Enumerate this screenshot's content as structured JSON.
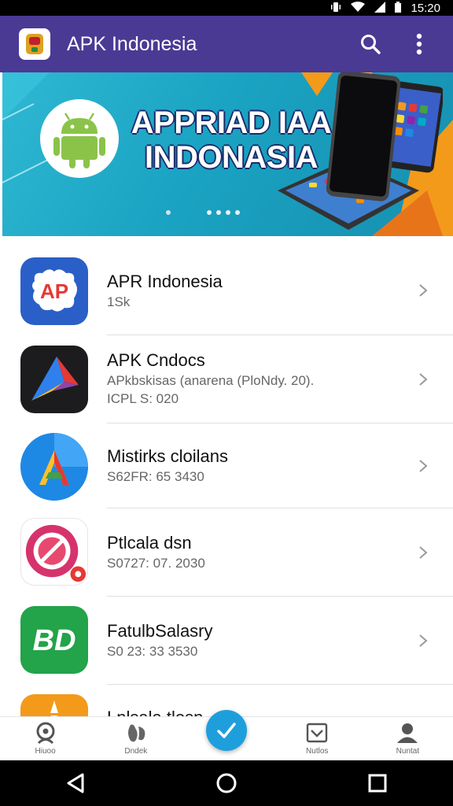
{
  "status_bar": {
    "time": "15:20"
  },
  "app_bar": {
    "title": "APK Indonesia"
  },
  "banner": {
    "title": "APPRIAD IAA INDONASIA",
    "slides": 5
  },
  "apps": [
    {
      "name": "APR Indonesia",
      "subtitle": "1Sk",
      "subtitle2": "",
      "icon": "ap-badge-icon"
    },
    {
      "name": "APK Cndocs",
      "subtitle": "APkbskisas (anarena (PloNdy. 20).",
      "subtitle2": "ICPL S: 020",
      "icon": "paper-plane-icon"
    },
    {
      "name": "Mistirks cloilans",
      "subtitle": "S62FR: 65 3430",
      "subtitle2": "",
      "icon": "a-logo-icon"
    },
    {
      "name": "Ptlcala dsn",
      "subtitle": "S0727: 07. 2030",
      "subtitle2": "",
      "icon": "compass-icon"
    },
    {
      "name": "FatulbSalasry",
      "subtitle": "S0 23: 33 3530",
      "subtitle2": "",
      "icon": "bd-logo-icon"
    },
    {
      "name": "Lnlsala tlosn",
      "subtitle": "",
      "subtitle2": "",
      "icon": "sun-logo-icon"
    }
  ],
  "bottom_nav": [
    {
      "label": "Hiuoo",
      "icon": "home-icon"
    },
    {
      "label": "Dndek",
      "icon": "bean-icon"
    },
    {
      "label": "",
      "icon": "check-fab-icon"
    },
    {
      "label": "Nutlos",
      "icon": "inbox-icon"
    },
    {
      "label": "Nuntat",
      "icon": "profile-icon"
    }
  ],
  "colors": {
    "app_bar": "#4a3a94",
    "banner": "#1aa3c2",
    "fab": "#1e9fdc",
    "accent_orange": "#f39a1a"
  }
}
